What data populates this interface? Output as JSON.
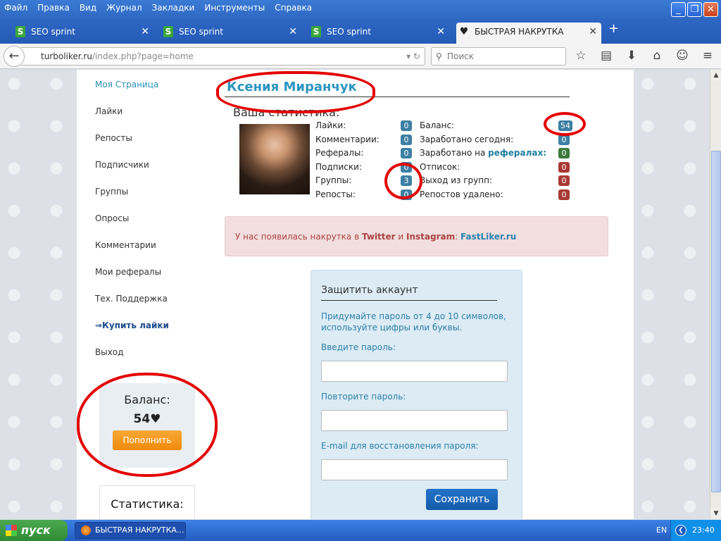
{
  "menubar": {
    "items": [
      "Файл",
      "Правка",
      "Вид",
      "Журнал",
      "Закладки",
      "Инструменты",
      "Справка"
    ]
  },
  "tabs": [
    {
      "label": "SEO sprint",
      "icon": "seo-sprint-icon"
    },
    {
      "label": "SEO sprint",
      "icon": "seo-sprint-icon"
    },
    {
      "label": "SEO sprint",
      "icon": "seo-sprint-icon"
    },
    {
      "label": "БЫСТРАЯ НАКРУТКА ЛАЙКО...",
      "icon": "heart-icon"
    }
  ],
  "address": {
    "host": "turboliker.ru",
    "path": "/index.php?page=home"
  },
  "search": {
    "placeholder": "Поиск"
  },
  "sidebar": {
    "items": [
      {
        "label": "Моя Страница"
      },
      {
        "label": "Лайки"
      },
      {
        "label": "Репосты"
      },
      {
        "label": "Подписчики"
      },
      {
        "label": "Группы"
      },
      {
        "label": "Опросы"
      },
      {
        "label": "Комментарии"
      },
      {
        "label": "Мои рефералы"
      },
      {
        "label": "Тех. Поддержка"
      },
      {
        "label": "⇒Купить лайки"
      },
      {
        "label": "Выход"
      }
    ],
    "balance_label": "Баланс:",
    "balance_value": "54♥",
    "topup_button": "Пополнить",
    "stats_title": "Статистика:"
  },
  "profile": {
    "name": "Ксения Миранчук",
    "stats_heading": "Ваша статистика:",
    "left_stats": [
      {
        "label": "Лайки:",
        "value": "0"
      },
      {
        "label": "Комментарии:",
        "value": "0"
      },
      {
        "label": "Рефералы:",
        "value": "0"
      },
      {
        "label": "Подписки:",
        "value": "0"
      },
      {
        "label": "Группы:",
        "value": "3"
      },
      {
        "label": "Репосты:",
        "value": "0"
      }
    ],
    "right_stats": [
      {
        "label": "Баланс:",
        "value": "54"
      },
      {
        "label": "Заработано сегодня:",
        "value": "0"
      },
      {
        "label_prefix": "Заработано на ",
        "label_bold": "рефералах:",
        "value": "0"
      },
      {
        "label": "Отписок:",
        "value": "0"
      },
      {
        "label": "Выход из групп:",
        "value": "0"
      },
      {
        "label": "Репостов удалено:",
        "value": "0"
      }
    ]
  },
  "alert": {
    "prefix": "У нас появилась накрутка в ",
    "twitter": "Twitter",
    "and": " и ",
    "instagram": "Instagram",
    "colon": ": ",
    "site": "FastLiker.ru"
  },
  "protect": {
    "title": "Защитить аккаунт",
    "description": "Придумайте пароль от 4 до 10 символов, используйте цифры или буквы.",
    "password_label": "Введите пароль:",
    "repeat_label": "Повторите пароль:",
    "email_label": "E-mail для восстановления пароля:",
    "save_button": "Сохранить"
  },
  "taskbar": {
    "start": "пуск",
    "task": "БЫСТРАЯ НАКРУТКА...",
    "lang": "EN",
    "time": "23:40"
  },
  "colors": {
    "accent": "#2b95bf",
    "alert_bg": "#f2dede",
    "annotation": "#e30000"
  }
}
